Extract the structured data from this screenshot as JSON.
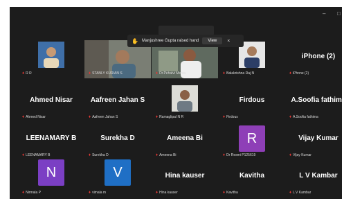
{
  "window": {
    "minimize": "–",
    "maximize": "□"
  },
  "notification": {
    "text": "Manjushree Gupta raised hand",
    "view_label": "View",
    "close": "×"
  },
  "participants": [
    {
      "id": "rr",
      "label": "R R",
      "photo": true
    },
    {
      "id": "stanly",
      "label": "STANLY KURIAN S",
      "video": true
    },
    {
      "id": "pehalvi",
      "label": "Dr.Pehalvi Mehta",
      "video": true
    },
    {
      "id": "balakrishna",
      "label": "Balakrishna Raj N",
      "photo": true
    },
    {
      "id": "iphone",
      "name": "iPhone (2)",
      "label": "iPhone (2)"
    },
    {
      "id": "ahmed",
      "name": "Ahmed Nisar",
      "label": "Ahmed Nisar"
    },
    {
      "id": "aafreen",
      "name": "Aafreen Jahan S",
      "label": "Aafreen Jahan S"
    },
    {
      "id": "ramalingal",
      "label": "Ramaglipal N R",
      "photo": true
    },
    {
      "id": "firdous",
      "name": "Firdous",
      "label": "Firdous"
    },
    {
      "id": "asoofia",
      "name": "A.Soofia fathima",
      "label": "A.Soofia fathima"
    },
    {
      "id": "leenamary",
      "name": "LEENAMARY B",
      "label": "LEENAMARY B"
    },
    {
      "id": "surekha",
      "name": "Surekha D",
      "label": "Surekha D"
    },
    {
      "id": "ameena",
      "name": "Ameena Bi",
      "label": "Ameena Bi"
    },
    {
      "id": "drr",
      "avatar": "R",
      "avatar_color": "#8e3fb7",
      "label": "Dr Resmi P125619"
    },
    {
      "id": "vijay",
      "name": "Vijay Kumar",
      "label": "Vijay Kumar"
    },
    {
      "id": "nirmala",
      "avatar": "N",
      "avatar_color": "#7b3fc4",
      "label": "Nirmala P"
    },
    {
      "id": "vimala",
      "avatar": "V",
      "avatar_color": "#1f6fc5",
      "label": "vimala m"
    },
    {
      "id": "hina",
      "name": "Hina kauser",
      "label": "Hina kauser"
    },
    {
      "id": "kavitha",
      "name": "Kavitha",
      "label": "Kavitha"
    },
    {
      "id": "lvkambar",
      "name": "L V Kambar",
      "label": "L V Kambar"
    }
  ]
}
